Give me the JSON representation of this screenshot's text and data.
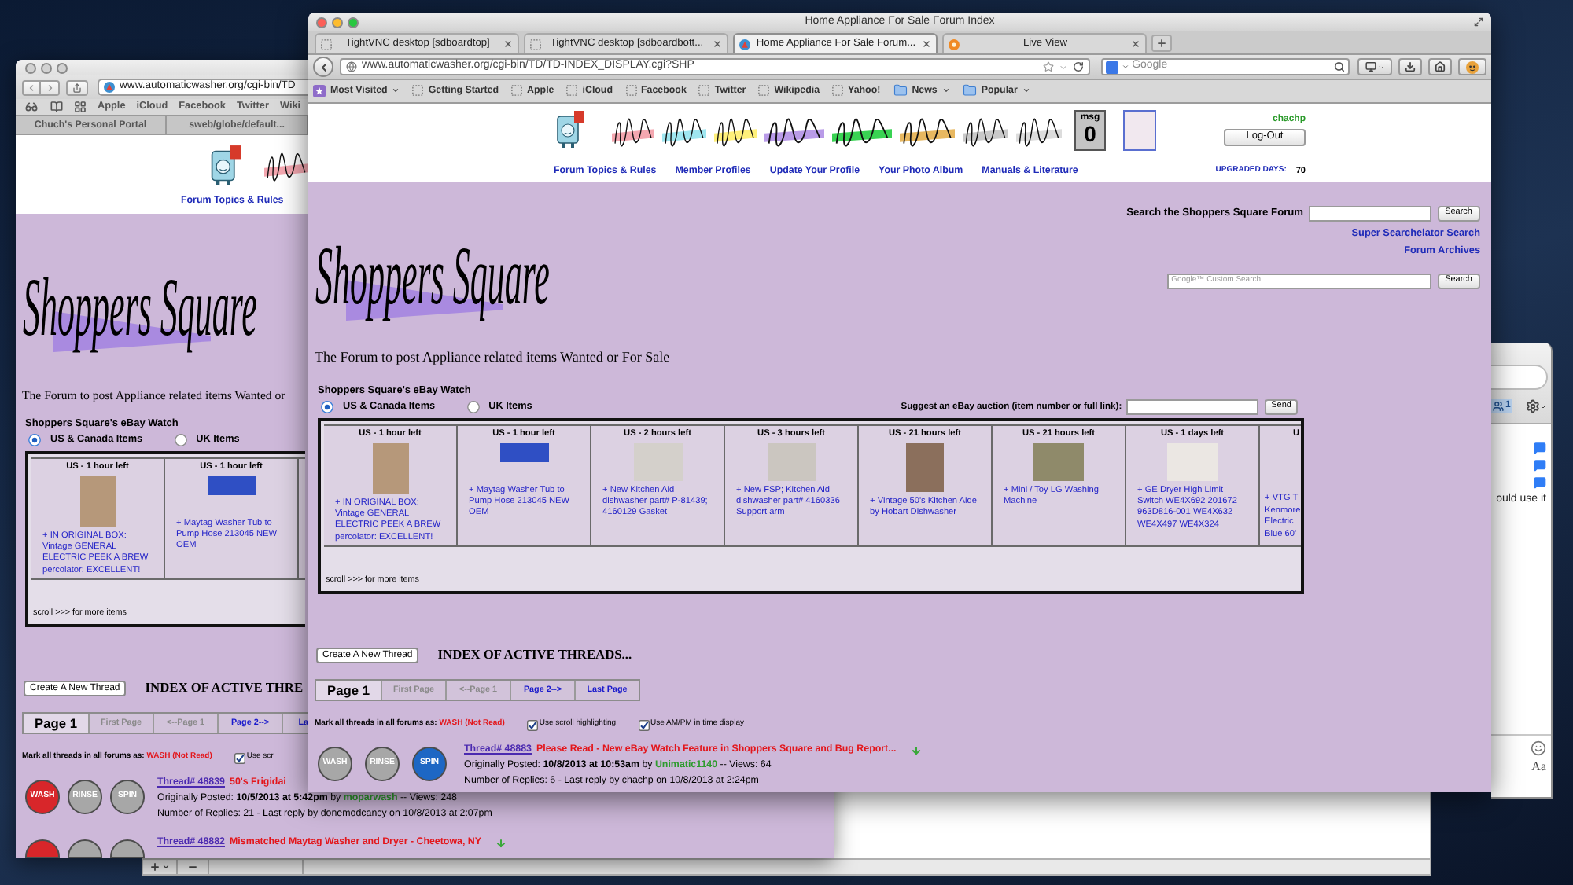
{
  "back_browser": {
    "url": "www.automaticwasher.org/cgi-bin/TD",
    "bookmarks": [
      "Apple",
      "iCloud",
      "Facebook",
      "Twitter",
      "Wiki"
    ],
    "tabs": [
      {
        "label": "Chuch's Personal Portal",
        "selected": false
      },
      {
        "label": "sweb/globe/default...",
        "selected": false
      }
    ],
    "page": {
      "nav_links": [
        "Forum Topics & Rules"
      ],
      "logo_text": "Shoppers Square",
      "tagline": "The Forum to post Appliance related items Wanted or",
      "ebay_watch": {
        "title": "Shoppers Square's eBay Watch",
        "regions": [
          {
            "label": "US & Canada Items",
            "selected": true
          },
          {
            "label": "UK Items",
            "selected": false
          }
        ],
        "items": [
          {
            "time_left": "US - 1 hour left",
            "title": "+ IN ORIGINAL BOX: Vintage GENERAL ELECTRIC PEEK A BREW percolator: EXCELLENT!"
          },
          {
            "time_left": "US - 1 hour left",
            "title": "+ Maytag Washer Tub to Pump Hose 213045 NEW OEM"
          }
        ],
        "scroll_hint": "scroll >>> for more items"
      },
      "new_thread_button": "Create A New Thread",
      "index_title": "INDEX OF ACTIVE THRE",
      "pagination": [
        {
          "label": "Page 1",
          "selected": true,
          "disabled": false
        },
        {
          "label": "First Page",
          "selected": false,
          "disabled": true
        },
        {
          "label": "<--Page 1",
          "selected": false,
          "disabled": true
        },
        {
          "label": "Page 2-->",
          "selected": false,
          "disabled": false
        },
        {
          "label": "La",
          "selected": false,
          "disabled": false
        }
      ],
      "mark_all": {
        "label": "Mark all threads in all forums as:",
        "value": "WASH (Not Read)"
      },
      "options": [
        {
          "label": "Use scr",
          "checked": true
        }
      ],
      "threads": [
        {
          "status": [
            {
              "label": "WASH",
              "color": "#d8262a"
            },
            {
              "label": "RINSE",
              "color": "#a7a7a7"
            },
            {
              "label": "SPIN",
              "color": "#a7a7a7"
            }
          ],
          "number": "Thread# 48839",
          "title": "50's Frigidai",
          "posted": {
            "text": "Originally Posted: **10/5/2013 at 5:42pm** by",
            "author": "moparwash",
            "views": "-- Views: 248"
          },
          "replies": "Number of Replies: 21 - Last reply by donemodcancy on 10/8/2013 at 2:07pm"
        },
        {
          "status": [
            {
              "color": "#d8262a"
            },
            {
              "color": "#a7a7a7"
            },
            {
              "color": "#a7a7a7"
            }
          ],
          "number": "Thread# 48882",
          "title": "Mismatched Maytag Washer and Dryer - Cheetowa, NY",
          "new_marker": true
        }
      ]
    }
  },
  "front_browser": {
    "title": "Home Appliance For Sale Forum Index",
    "tabs": [
      {
        "label": "TightVNC desktop [sdboardtop]",
        "kind": "blank",
        "selected": false
      },
      {
        "label": "TightVNC desktop [sdboardbott...",
        "kind": "blank",
        "selected": false
      },
      {
        "label": "Home Appliance For Sale Forum...",
        "kind": "site",
        "selected": true
      },
      {
        "label": "Live View",
        "kind": "live",
        "selected": false
      }
    ],
    "url": "www.automaticwasher.org/cgi-bin/TD/TD-INDEX_DISPLAY.cgi?SHP",
    "search_placeholder": "Google",
    "bookmarks": [
      {
        "label": "Most Visited",
        "kind": "menu"
      },
      {
        "label": "Getting Started",
        "kind": "page"
      },
      {
        "label": "Apple",
        "kind": "page"
      },
      {
        "label": "iCloud",
        "kind": "page"
      },
      {
        "label": "Facebook",
        "kind": "page"
      },
      {
        "label": "Twitter",
        "kind": "page"
      },
      {
        "label": "Wikipedia",
        "kind": "page"
      },
      {
        "label": "Yahoo!",
        "kind": "page"
      },
      {
        "label": "News",
        "kind": "folder"
      },
      {
        "label": "Popular",
        "kind": "folder"
      }
    ],
    "page": {
      "header": {
        "msg_label": "msg",
        "msg_count": "0",
        "user": "chachp",
        "logout_button": "Log-Out",
        "nav_links": [
          "Forum Topics & Rules",
          "Member Profiles",
          "Update Your Profile",
          "Your Photo Album",
          "Manuals & Literature"
        ],
        "upgraded_label": "UPGRADED DAYS:",
        "upgraded_value": "70"
      },
      "forum_search": {
        "label": "Search the Shoppers Square Forum",
        "button": "Search",
        "links": [
          "Super Searchelator Search",
          "Forum Archives"
        ],
        "custom_search_placeholder": "Google™ Custom Search",
        "custom_search_button": "Search"
      },
      "logo_text": "Shoppers Square",
      "tagline": "The Forum to post Appliance related items Wanted or For Sale",
      "ebay_watch": {
        "title": "Shoppers Square's eBay Watch",
        "regions": [
          {
            "label": "US & Canada Items",
            "selected": true
          },
          {
            "label": "UK Items",
            "selected": false
          }
        ],
        "suggest_label": "Suggest an eBay auction (item number or full link):",
        "send_button": "Send",
        "items": [
          {
            "time_left": "US - 1 hour left",
            "title": "+ IN ORIGINAL BOX: Vintage GENERAL ELECTRIC PEEK A BREW percolator: EXCELLENT!"
          },
          {
            "time_left": "US - 1 hour left",
            "title": "+ Maytag Washer Tub to Pump Hose 213045 NEW OEM"
          },
          {
            "time_left": "US - 2 hours left",
            "title": "+ New Kitchen Aid dishwasher part# P-81439; 4160129 Gasket"
          },
          {
            "time_left": "US - 3 hours left",
            "title": "+ New FSP; Kitchen Aid dishwasher part# 4160336 Support arm"
          },
          {
            "time_left": "US - 21 hours left",
            "title": "+ Vintage 50's Kitchen Aide by Hobart Dishwasher"
          },
          {
            "time_left": "US - 21 hours left",
            "title": "+ Mini / Toy LG Washing Machine"
          },
          {
            "time_left": "US - 1 days left",
            "title": "+ GE Dryer High Limit Switch WE4X692 201672 963D816-001 WE4X632 WE4X497 WE4X324"
          }
        ],
        "cut_item": {
          "time_left": "U",
          "lines": [
            "+ VTG T",
            "Kenmore",
            "Electric",
            "Blue 60'"
          ]
        },
        "scroll_hint": "scroll >>> for more items"
      },
      "new_thread_button": "Create A New Thread",
      "index_title": "INDEX OF ACTIVE THREADS...",
      "pagination": [
        {
          "label": "Page 1",
          "selected": true,
          "disabled": false
        },
        {
          "label": "First Page",
          "selected": false,
          "disabled": true
        },
        {
          "label": "<--Page 1",
          "selected": false,
          "disabled": true
        },
        {
          "label": "Page 2-->",
          "selected": false,
          "disabled": false
        },
        {
          "label": "Last Page",
          "selected": false,
          "disabled": false
        }
      ],
      "mark_all": {
        "label": "Mark all threads in all forums as:",
        "value": "WASH (Not Read)"
      },
      "options": [
        {
          "label": "Use scroll highlighting",
          "checked": true
        },
        {
          "label": "Use AM/PM in time display",
          "checked": true
        }
      ],
      "threads": [
        {
          "status": [
            {
              "label": "WASH",
              "color": "#a7a7a7"
            },
            {
              "label": "RINSE",
              "color": "#a7a7a7"
            },
            {
              "label": "SPIN",
              "color": "#1d67c4"
            }
          ],
          "number": "Thread# 48883",
          "title": "Please Read - New eBay Watch Feature in Shoppers Square and Bug Report...",
          "new_marker": true,
          "posted": {
            "text": "Originally Posted: **10/8/2013 at 10:53am** by",
            "author": "Unimatic1140",
            "views": "-- Views: 64"
          },
          "replies": "Number of Replies: 6 - Last reply by chachp on 10/8/2013 at 2:24pm"
        }
      ]
    }
  },
  "chat_window": {
    "badge": "1",
    "message": "ould use it",
    "format_button": "Aa"
  }
}
